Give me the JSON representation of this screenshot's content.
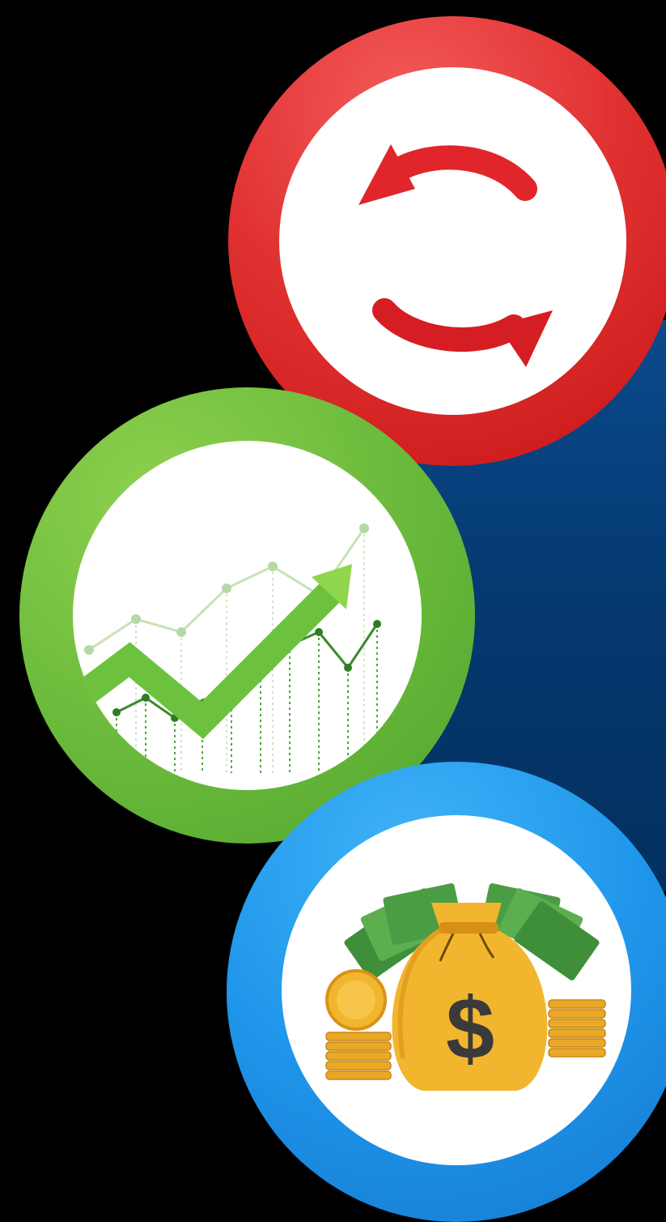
{
  "badges": [
    {
      "icon": "refresh-arrows-icon",
      "ring_color": "#e03030"
    },
    {
      "icon": "growth-chart-icon",
      "ring_color": "#6cbb3c"
    },
    {
      "icon": "money-bag-icon",
      "ring_color": "#1f96ea"
    }
  ],
  "money_bag": {
    "symbol": "$"
  },
  "colors": {
    "background": "#000000",
    "panel": "#053a72",
    "arrow_red": "#e0262b",
    "arrow_green": "#6cc23e",
    "gold": "#f2b52e"
  }
}
